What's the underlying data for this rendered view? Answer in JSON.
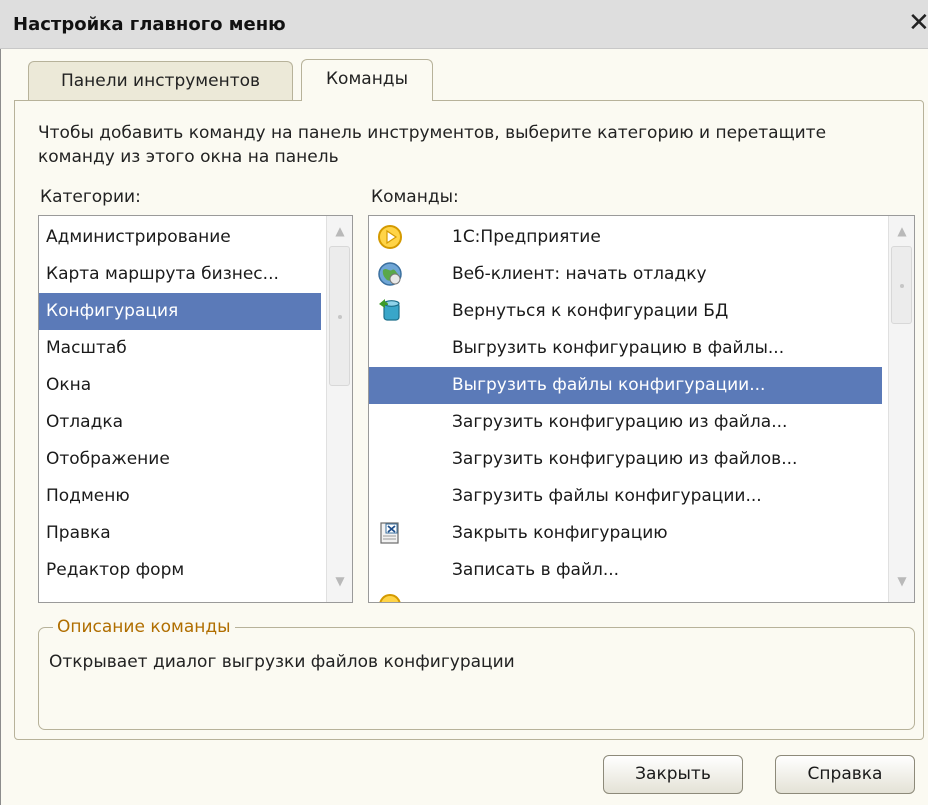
{
  "window": {
    "title": "Настройка главного меню",
    "close_glyph": "✕"
  },
  "tabs": [
    {
      "label": "Панели инструментов",
      "active": false
    },
    {
      "label": "Команды",
      "active": true
    }
  ],
  "instructions": "Чтобы добавить команду на панель инструментов, выберите категорию и перетащите команду из этого окна на панель",
  "categories": {
    "label": "Категории:",
    "selected_index": 2,
    "items": [
      "Администрирование",
      "Карта маршрута бизнес...",
      "Конфигурация",
      "Масштаб",
      "Окна",
      "Отладка",
      "Отображение",
      "Подменю",
      "Правка",
      "Редактор форм"
    ]
  },
  "commands": {
    "label": "Команды:",
    "selected_index": 4,
    "items": [
      {
        "label": "1С:Предприятие",
        "icon": "play-circle-icon"
      },
      {
        "label": "Веб-клиент: начать отладку",
        "icon": "globe-debug-icon"
      },
      {
        "label": "Вернуться к конфигурации БД",
        "icon": "database-return-icon"
      },
      {
        "label": "Выгрузить конфигурацию в файлы...",
        "icon": ""
      },
      {
        "label": "Выгрузить файлы конфигурации...",
        "icon": ""
      },
      {
        "label": "Загрузить конфигурацию из файла...",
        "icon": ""
      },
      {
        "label": "Загрузить конфигурацию из файлов...",
        "icon": ""
      },
      {
        "label": "Загрузить файлы конфигурации...",
        "icon": ""
      },
      {
        "label": "Закрыть конфигурацию",
        "icon": "close-config-icon"
      },
      {
        "label": "Записать в файл...",
        "icon": ""
      }
    ]
  },
  "description": {
    "legend": "Описание команды",
    "text": "Открывает диалог выгрузки файлов конфигурации"
  },
  "buttons": {
    "close": "Закрыть",
    "help": "Справка"
  },
  "colors": {
    "selection": "#5b7ab8",
    "legend": "#b06e00",
    "dialog_bg": "#fbfaf2"
  }
}
